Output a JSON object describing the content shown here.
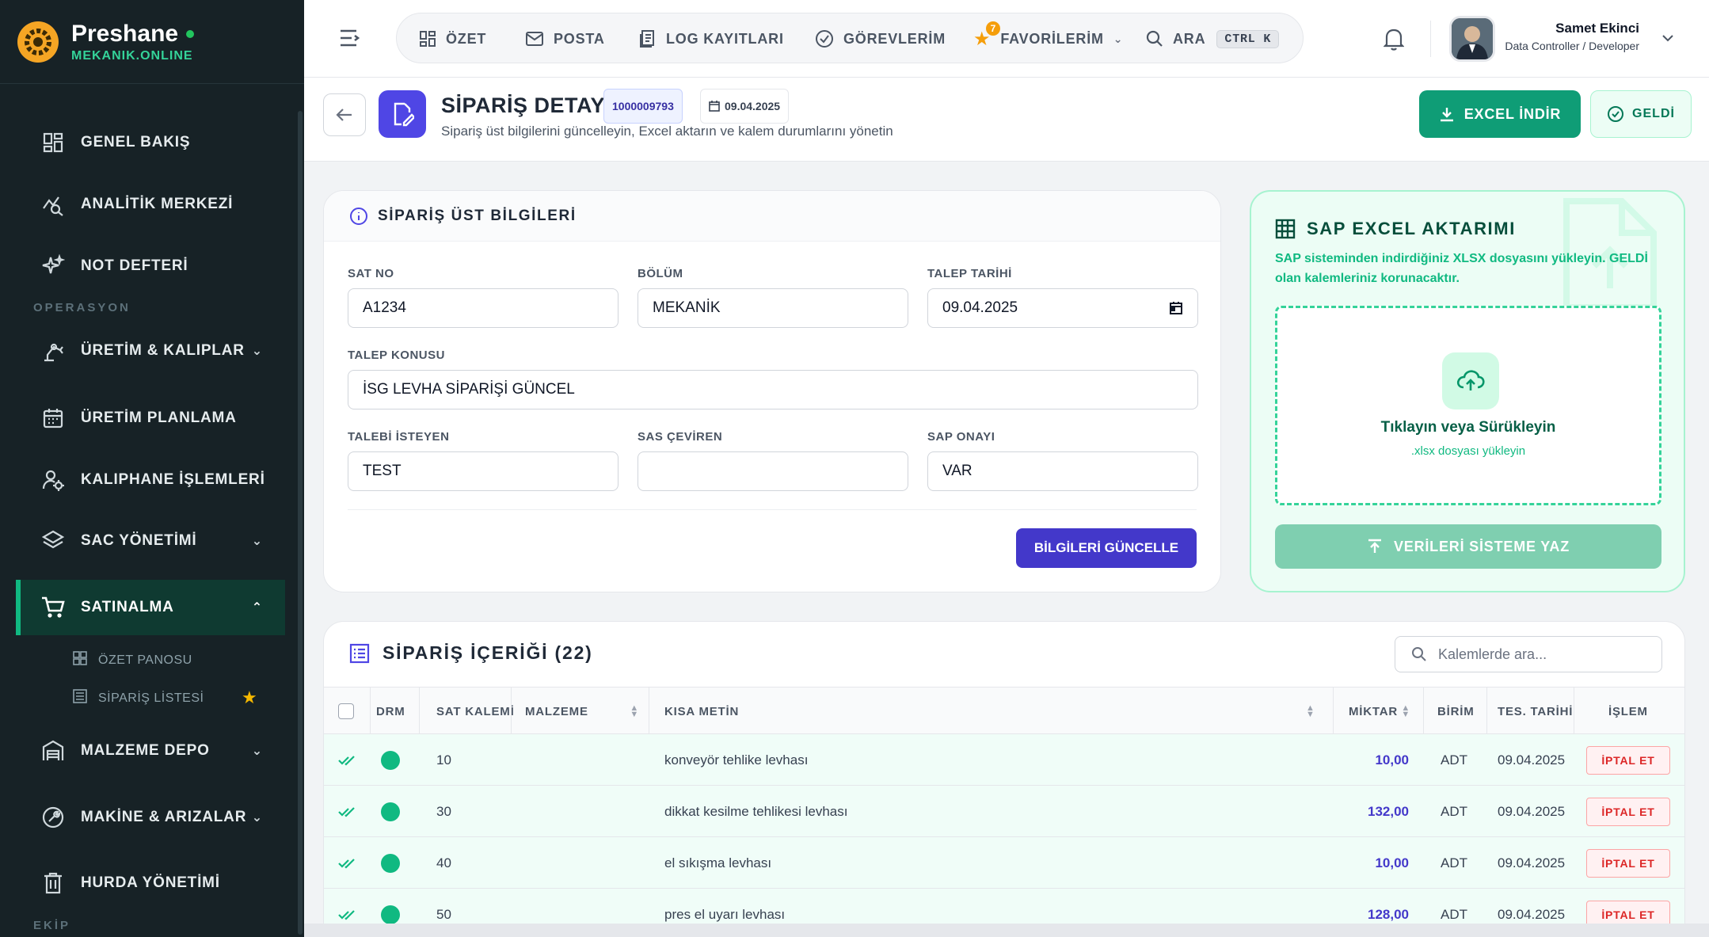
{
  "brand": {
    "name": "Preshane",
    "sub": "MEKANIK.ONLINE",
    "accent": "#10b981"
  },
  "sidebar": {
    "items": [
      {
        "label": "GENEL BAKIŞ",
        "icon": "dashboard-icon"
      },
      {
        "label": "ANALİTİK MERKEZİ",
        "icon": "analytics-icon"
      },
      {
        "label": "NOT DEFTERİ",
        "icon": "sparkle-icon"
      },
      {
        "label": "ÜRETİM & KALIPLAR",
        "icon": "robot-arm-icon"
      },
      {
        "label": "ÜRETİM PLANLAMA",
        "icon": "calendar-icon"
      },
      {
        "label": "KALIPHANE İŞLEMLERİ",
        "icon": "user-gear-icon"
      },
      {
        "label": "SAC YÖNETİMİ",
        "icon": "layers-icon"
      },
      {
        "label": "SATINALMA",
        "icon": "cart-icon"
      },
      {
        "label": "MALZEME DEPO",
        "icon": "warehouse-icon"
      },
      {
        "label": "MAKİNE & ARIZALAR",
        "icon": "wrench-icon"
      },
      {
        "label": "HURDA YÖNETİMİ",
        "icon": "trash-icon"
      }
    ],
    "section_operasyon": "OPERASYON",
    "section_ekip": "EKİP",
    "sub_items": [
      {
        "label": "ÖZET PANOSU",
        "icon": "grid-icon"
      },
      {
        "label": "SİPARİŞ LİSTESİ",
        "icon": "list-icon",
        "starred": true
      }
    ]
  },
  "topnav": {
    "items": [
      {
        "label": "ÖZET",
        "icon": "grid-icon"
      },
      {
        "label": "POSTA",
        "icon": "mail-icon"
      },
      {
        "label": "LOG KAYITLARI",
        "icon": "log-icon"
      },
      {
        "label": "GÖREVLERİM",
        "icon": "check-circle-icon"
      },
      {
        "label": "FAVORİLERİM",
        "icon": "star-icon",
        "badge": "7"
      },
      {
        "label": "ARA",
        "icon": "search-icon",
        "shortcut": "CTRL K"
      }
    ]
  },
  "user": {
    "name": "Samet Ekinci",
    "role": "Data Controller / Developer"
  },
  "page": {
    "title": "SİPARİŞ DETAYI",
    "order_id": "1000009793",
    "date": "09.04.2025",
    "subtitle": "Sipariş üst bilgilerini güncelleyin, Excel aktarın ve kalem durumlarını yönetin",
    "excel_button": "EXCEL İNDİR",
    "geldi_button": "GELDİ"
  },
  "info_card": {
    "title": "SİPARİŞ ÜST BİLGİLERİ",
    "fields": {
      "sat_no": {
        "label": "SAT NO",
        "value": "A1234"
      },
      "bolum": {
        "label": "BÖLÜM",
        "value": "MEKANİK"
      },
      "talep_tarihi": {
        "label": "TALEP TARİHİ",
        "value": "09.04.2025"
      },
      "talep_konusu": {
        "label": "TALEP KONUSU",
        "value": "İSG LEVHA SİPARİŞİ GÜNCEL"
      },
      "talebi_isteyen": {
        "label": "TALEBİ İSTEYEN",
        "value": "TEST"
      },
      "sas_ceviren": {
        "label": "SAS ÇEVİREN",
        "value": ""
      },
      "sap_onayi": {
        "label": "SAP ONAYI",
        "value": "VAR"
      }
    },
    "update_button": "BİLGİLERİ GÜNCELLE"
  },
  "sap_card": {
    "title": "SAP EXCEL AKTARIMI",
    "description": "SAP sisteminden indirdiğiniz XLSX dosyasını yükleyin. GELDİ olan kalemleriniz korunacaktır.",
    "drop_title": "Tıklayın veya Sürükleyin",
    "drop_sub": ".xlsx dosyası yükleyin",
    "write_button": "VERİLERİ SİSTEME YAZ"
  },
  "table": {
    "title": "SİPARİŞ İÇERİĞİ (22)",
    "search_placeholder": "Kalemlerde ara...",
    "headers": [
      "DRM",
      "SAT KALEMİ",
      "MALZEME",
      "KISA METİN",
      "MİKTAR",
      "BİRİM",
      "TES. TARİHİ",
      "İŞLEM"
    ],
    "rows": [
      {
        "kalem": "10",
        "malzeme": "",
        "metin": "konveyör tehlike levhası",
        "miktar": "10,00",
        "birim": "ADT",
        "tarih": "09.04.2025",
        "islem": "İPTAL ET"
      },
      {
        "kalem": "30",
        "malzeme": "",
        "metin": "dikkat kesilme tehlikesi levhası",
        "miktar": "132,00",
        "birim": "ADT",
        "tarih": "09.04.2025",
        "islem": "İPTAL ET"
      },
      {
        "kalem": "40",
        "malzeme": "",
        "metin": "el sıkışma levhası",
        "miktar": "10,00",
        "birim": "ADT",
        "tarih": "09.04.2025",
        "islem": "İPTAL ET"
      },
      {
        "kalem": "50",
        "malzeme": "",
        "metin": "pres el uyarı levhası",
        "miktar": "128,00",
        "birim": "ADT",
        "tarih": "09.04.2025",
        "islem": "İPTAL ET"
      }
    ]
  }
}
